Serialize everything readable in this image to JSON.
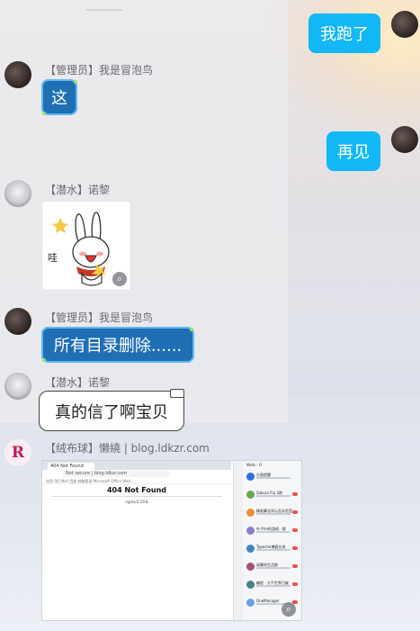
{
  "messages": [
    {
      "id": "m1",
      "side": "right",
      "text": "我跑了"
    },
    {
      "id": "m2",
      "side": "left",
      "sender": "【管理员】我是冒泡鸟",
      "text": "这"
    },
    {
      "id": "m3",
      "side": "right",
      "text": "再见"
    },
    {
      "id": "m4",
      "side": "left",
      "sender": "【潜水】诺黎",
      "type": "sticker",
      "sticker": "bunny-sticker"
    },
    {
      "id": "m5",
      "side": "left",
      "sender": "【管理员】我是冒泡鸟",
      "text": "所有目录删除......"
    },
    {
      "id": "m6",
      "side": "left",
      "sender": "【潜水】诺黎",
      "text": "真的信了啊宝贝"
    },
    {
      "id": "m7",
      "side": "left",
      "sender": "【绒布球】懒繞 | blog.ldkzr.com",
      "type": "image"
    }
  ],
  "avatar_logo_letter": "R",
  "screenshot": {
    "tab_title": "404 Not Found",
    "url": "Not secure | blog.ldkzr.com",
    "bookmarks": "应用  QQ Mail  百度  邮箱登录  Microsoft Office Web...  ...",
    "heading": "404 Not Found",
    "subtext": "nginx/1.19.8",
    "qq_header": "Web · 0",
    "qq_items": [
      {
        "title": "分类提醒",
        "color": "#2b6fe6"
      },
      {
        "title": "Sakura Frp 2群",
        "color": "#6aa84f"
      },
      {
        "title": "精准算法学以及实验室",
        "color": "#e69138"
      },
      {
        "title": "叶子lm的游戏 · 群",
        "color": "#8e7cc3"
      },
      {
        "title": "Typecho博客交流",
        "color": "#3d85c6"
      },
      {
        "title": "闲聊的生活群",
        "color": "#a64d79"
      },
      {
        "title": "编程 · 大千世界已被",
        "color": "#45818e"
      },
      {
        "title": "OneManager",
        "color": "#6d9eeb"
      }
    ]
  },
  "icons": [
    "zoom-icon",
    "zoom-icon"
  ],
  "colors": {
    "me_bubble": "#12b7f5",
    "admin_bubble": "#1f6fb4",
    "unread_badge": "#f44d4d"
  }
}
